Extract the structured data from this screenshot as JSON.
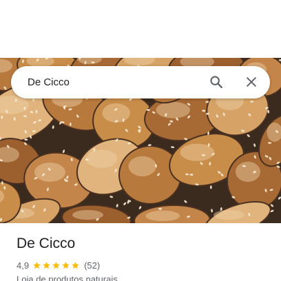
{
  "search": {
    "query": "De Cicco",
    "search_icon": "search-icon",
    "close_icon": "close-icon"
  },
  "photo": {
    "subject": "caramelized-cashews-photo"
  },
  "place": {
    "name": "De Cicco",
    "rating": "4,9",
    "stars": 5,
    "review_count": "(52)",
    "category": "Loja de produtos naturais"
  },
  "colors": {
    "star": "#fbbc04",
    "text_primary": "#202124",
    "text_secondary": "#5f6368",
    "icon": "#5f6368"
  }
}
